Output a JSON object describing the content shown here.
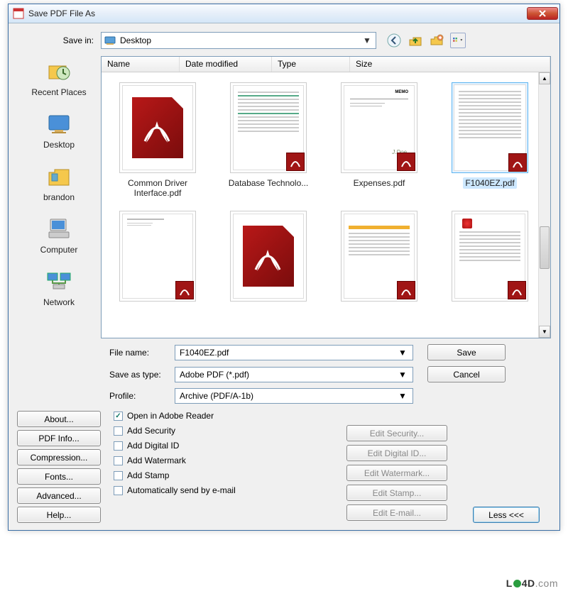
{
  "window": {
    "title": "Save PDF File As"
  },
  "savein": {
    "label": "Save in:",
    "value": "Desktop"
  },
  "toolbar_icons": [
    "back-icon",
    "up-icon",
    "new-folder-icon",
    "views-icon"
  ],
  "places": [
    {
      "label": "Recent Places"
    },
    {
      "label": "Desktop"
    },
    {
      "label": "brandon"
    },
    {
      "label": "Computer"
    },
    {
      "label": "Network"
    }
  ],
  "columns": [
    "Name",
    "Date modified",
    "Type",
    "Size"
  ],
  "files": [
    {
      "name": "Common Driver Interface.pdf",
      "kind": "big-pdf"
    },
    {
      "name": "Database Technolo...",
      "kind": "text-green"
    },
    {
      "name": "Expenses.pdf",
      "kind": "memo"
    },
    {
      "name": "F1040EZ.pdf",
      "kind": "form",
      "selected": true
    },
    {
      "name": "",
      "kind": "blank-form"
    },
    {
      "name": "",
      "kind": "big-pdf"
    },
    {
      "name": "",
      "kind": "text-yellow"
    },
    {
      "name": "",
      "kind": "text-dense"
    }
  ],
  "form": {
    "filename_label": "File name:",
    "filename_value": "F1040EZ.pdf",
    "savetype_label": "Save as type:",
    "savetype_value": "Adobe PDF (*.pdf)",
    "profile_label": "Profile:",
    "profile_value": "Archive (PDF/A-1b)"
  },
  "buttons": {
    "save": "Save",
    "cancel": "Cancel",
    "about": "About...",
    "pdfinfo": "PDF Info...",
    "compression": "Compression...",
    "fonts": "Fonts...",
    "advanced": "Advanced...",
    "help": "Help...",
    "less": "Less <<<"
  },
  "checks": {
    "open_reader": "Open in Adobe Reader",
    "add_security": "Add Security",
    "add_digital_id": "Add Digital ID",
    "add_watermark": "Add Watermark",
    "add_stamp": "Add Stamp",
    "auto_email": "Automatically send by e-mail"
  },
  "edit_buttons": {
    "security": "Edit Security...",
    "digital_id": "Edit Digital ID...",
    "watermark": "Edit Watermark...",
    "stamp": "Edit Stamp...",
    "email": "Edit E-mail..."
  },
  "watermark": "LO4D.com"
}
